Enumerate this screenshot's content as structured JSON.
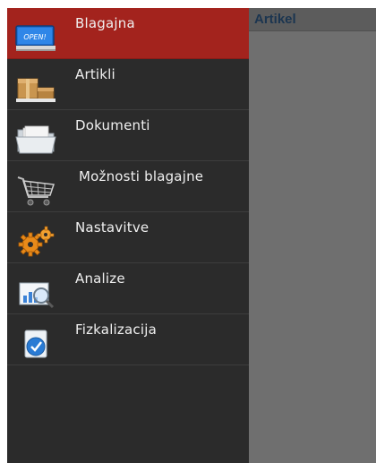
{
  "drawer": {
    "items": [
      {
        "id": "blagajna",
        "label": "Blagajna",
        "icon": "cash-register-open-icon",
        "selected": true,
        "icon_text": "OPEN!"
      },
      {
        "id": "artikli",
        "label": "Artikli",
        "icon": "boxes-icon",
        "selected": false
      },
      {
        "id": "dokumenti",
        "label": "Dokumenti",
        "icon": "folder-documents-icon",
        "selected": false
      },
      {
        "id": "moznosti",
        "label": "Možnosti blagajne",
        "icon": "shopping-cart-icon",
        "selected": false
      },
      {
        "id": "nastavitve",
        "label": "Nastavitve",
        "icon": "gears-icon",
        "selected": false
      },
      {
        "id": "analize",
        "label": "Analize",
        "icon": "analytics-magnifier-icon",
        "selected": false
      },
      {
        "id": "fiskalizacija",
        "label": "Fizkalizacija",
        "icon": "fiscal-check-icon",
        "selected": false
      }
    ]
  },
  "content": {
    "header_title": "Artikel"
  },
  "colors": {
    "drawer_bg": "#2b2b2b",
    "selected_bg": "#a3231d",
    "content_bg": "#6f6f6f",
    "header_title": "#1b3550"
  }
}
